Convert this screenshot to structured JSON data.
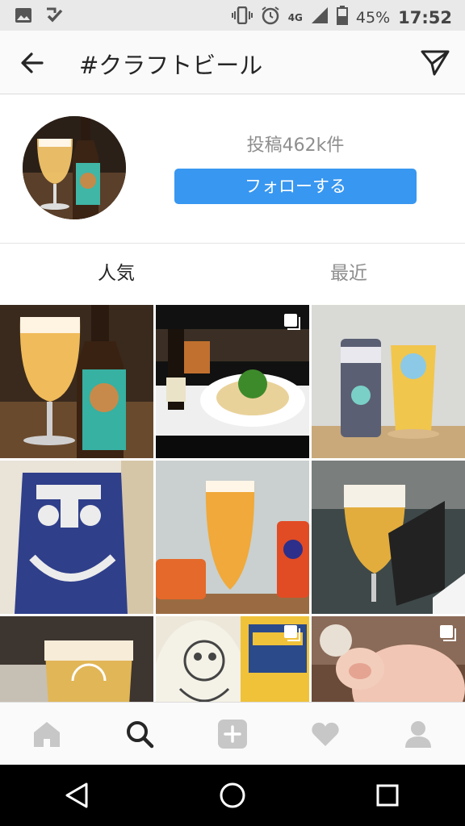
{
  "status_bar": {
    "battery_percent": "45%",
    "time": "17:52",
    "network": "4G",
    "icons": [
      "image-icon",
      "check-icon",
      "vibrate-icon",
      "alarm-icon",
      "signal-icon",
      "battery-icon"
    ]
  },
  "header": {
    "title": "#クラフトビール",
    "back_icon": "arrow-left-icon",
    "share_icon": "send-icon"
  },
  "profile": {
    "posts_label": "投稿462k件",
    "follow_label": "フォローする"
  },
  "tabs": [
    {
      "label": "人気",
      "active": true
    },
    {
      "label": "最近",
      "active": false
    }
  ],
  "grid": {
    "count": 9,
    "multi_photo_badge_cells": [
      1,
      7,
      8
    ]
  },
  "bottom_nav": [
    "home-icon",
    "search-icon",
    "add-icon",
    "heart-icon",
    "profile-icon"
  ],
  "system_nav": [
    "back-triangle-icon",
    "home-circle-icon",
    "recents-square-icon"
  ],
  "colors": {
    "accent": "#3897f0",
    "text": "#262626",
    "muted": "#8e8e8e"
  }
}
